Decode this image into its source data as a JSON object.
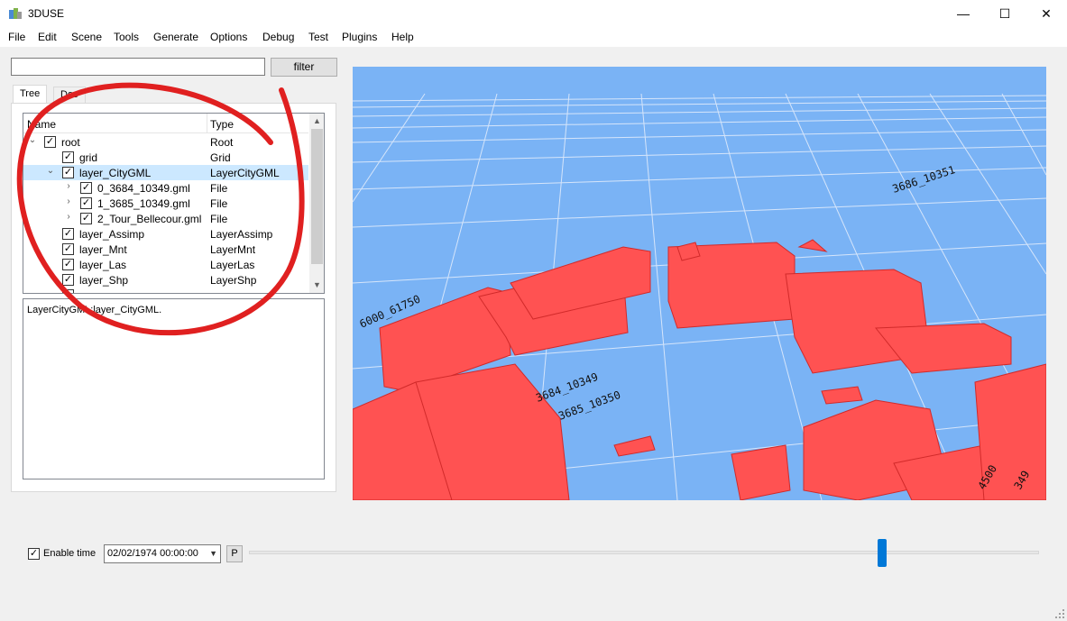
{
  "window": {
    "title": "3DUSE",
    "controls": {
      "minimize": "—",
      "maximize": "☐",
      "close": "✕"
    }
  },
  "menu": [
    "File",
    "Edit",
    "Scene",
    "Tools",
    "Generate",
    "Options",
    "Debug",
    "Test",
    "Plugins",
    "Help"
  ],
  "filter": {
    "value": "",
    "button_label": "filter"
  },
  "tabs": [
    {
      "label": "Tree",
      "active": true
    },
    {
      "label": "Doc",
      "active": false
    }
  ],
  "tree": {
    "columns": [
      "Name",
      "Type"
    ],
    "rows": [
      {
        "name": "root",
        "type": "Root",
        "checked": true,
        "expander": "chevron-down",
        "depth": 0
      },
      {
        "name": "grid",
        "type": "Grid",
        "checked": true,
        "expander": "",
        "depth": 1
      },
      {
        "name": "layer_CityGML",
        "type": "LayerCityGML",
        "checked": true,
        "expander": "chevron-down",
        "depth": 1,
        "selected": true
      },
      {
        "name": "0_3684_10349.gml",
        "type": "File",
        "checked": true,
        "expander": "chevron-right",
        "depth": 2
      },
      {
        "name": "1_3685_10349.gml",
        "type": "File",
        "checked": true,
        "expander": "chevron-right",
        "depth": 2
      },
      {
        "name": "2_Tour_Bellecour.gml",
        "type": "File",
        "checked": true,
        "expander": "chevron-right",
        "depth": 2
      },
      {
        "name": "layer_Assimp",
        "type": "LayerAssimp",
        "checked": true,
        "expander": "",
        "depth": 1
      },
      {
        "name": "layer_Mnt",
        "type": "LayerMnt",
        "checked": true,
        "expander": "",
        "depth": 1
      },
      {
        "name": "layer_Las",
        "type": "LayerLas",
        "checked": true,
        "expander": "",
        "depth": 1
      },
      {
        "name": "layer_Shp",
        "type": "LayerShp",
        "checked": true,
        "expander": "",
        "depth": 1
      }
    ]
  },
  "info": {
    "text": "LayerCityGML:layer_CityGML."
  },
  "viewport": {
    "background_color": "#7ab3f5",
    "building_color": "#ff4d4d",
    "ground_labels": [
      "3684_10349",
      "3685_10350",
      "6000_61750",
      "3686_10351",
      "4500",
      "349"
    ]
  },
  "timeline": {
    "enable_label": "Enable time",
    "enabled": true,
    "datetime": "02/02/1974 00:00:00",
    "p_button": "P",
    "position": 0.8
  },
  "annotation": {
    "color": "#e02020"
  }
}
